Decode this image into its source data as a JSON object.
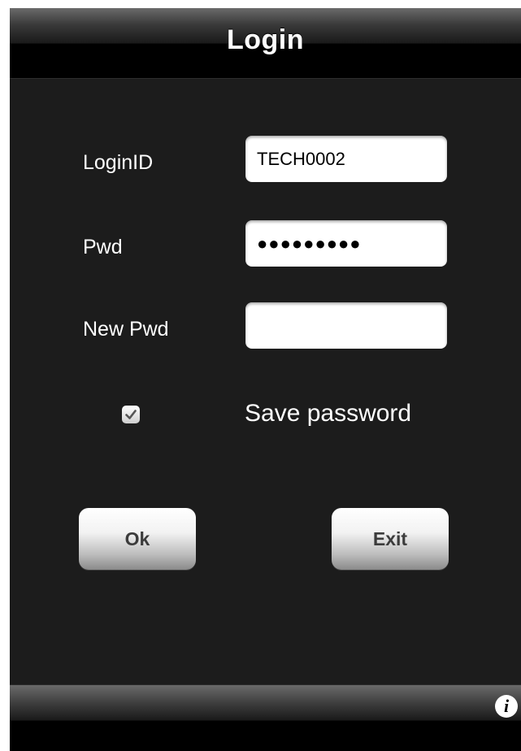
{
  "navbar": {
    "title": "Login"
  },
  "form": {
    "login_id": {
      "label": "LoginID",
      "value": "TECH0002"
    },
    "pwd": {
      "label": "Pwd",
      "masked_value": "●●●●●●●●●"
    },
    "new_pwd": {
      "label": "New Pwd",
      "value": ""
    },
    "save_password": {
      "label": "Save password",
      "checked": true
    }
  },
  "buttons": {
    "ok_label": "Ok",
    "exit_label": "Exit"
  },
  "toolbar": {
    "info_glyph": "i",
    "info_icon": "info-icon"
  },
  "colors": {
    "background": "#1c1c1c",
    "bar": "#000000",
    "text": "#ffffff",
    "button_text": "#3c3c3c"
  }
}
